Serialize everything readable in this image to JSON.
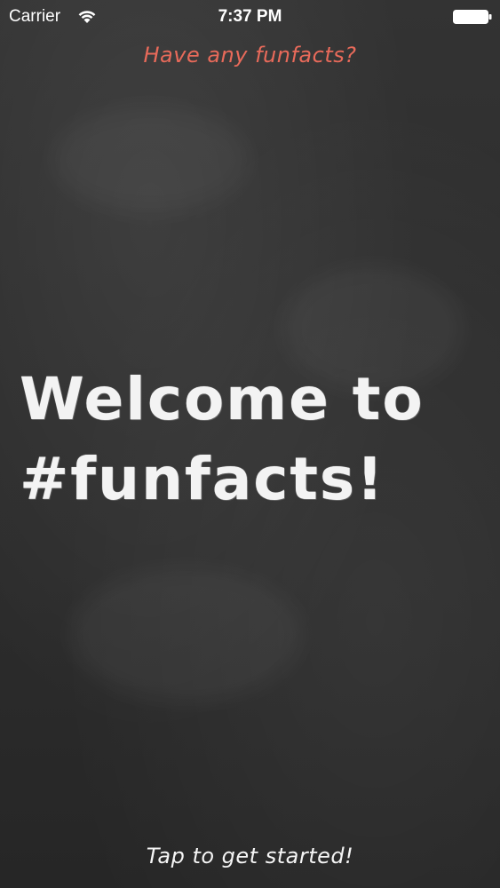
{
  "status_bar": {
    "carrier": "Carrier",
    "time": "7:37 PM"
  },
  "prompt": {
    "label": "Have any funfacts?",
    "color": "#e86a5a"
  },
  "welcome": {
    "line1": "Welcome to",
    "line2": "#funfacts!"
  },
  "cta": {
    "label": "Tap to get started!"
  },
  "icons": {
    "wifi": "wifi-icon",
    "battery": "battery-icon"
  }
}
